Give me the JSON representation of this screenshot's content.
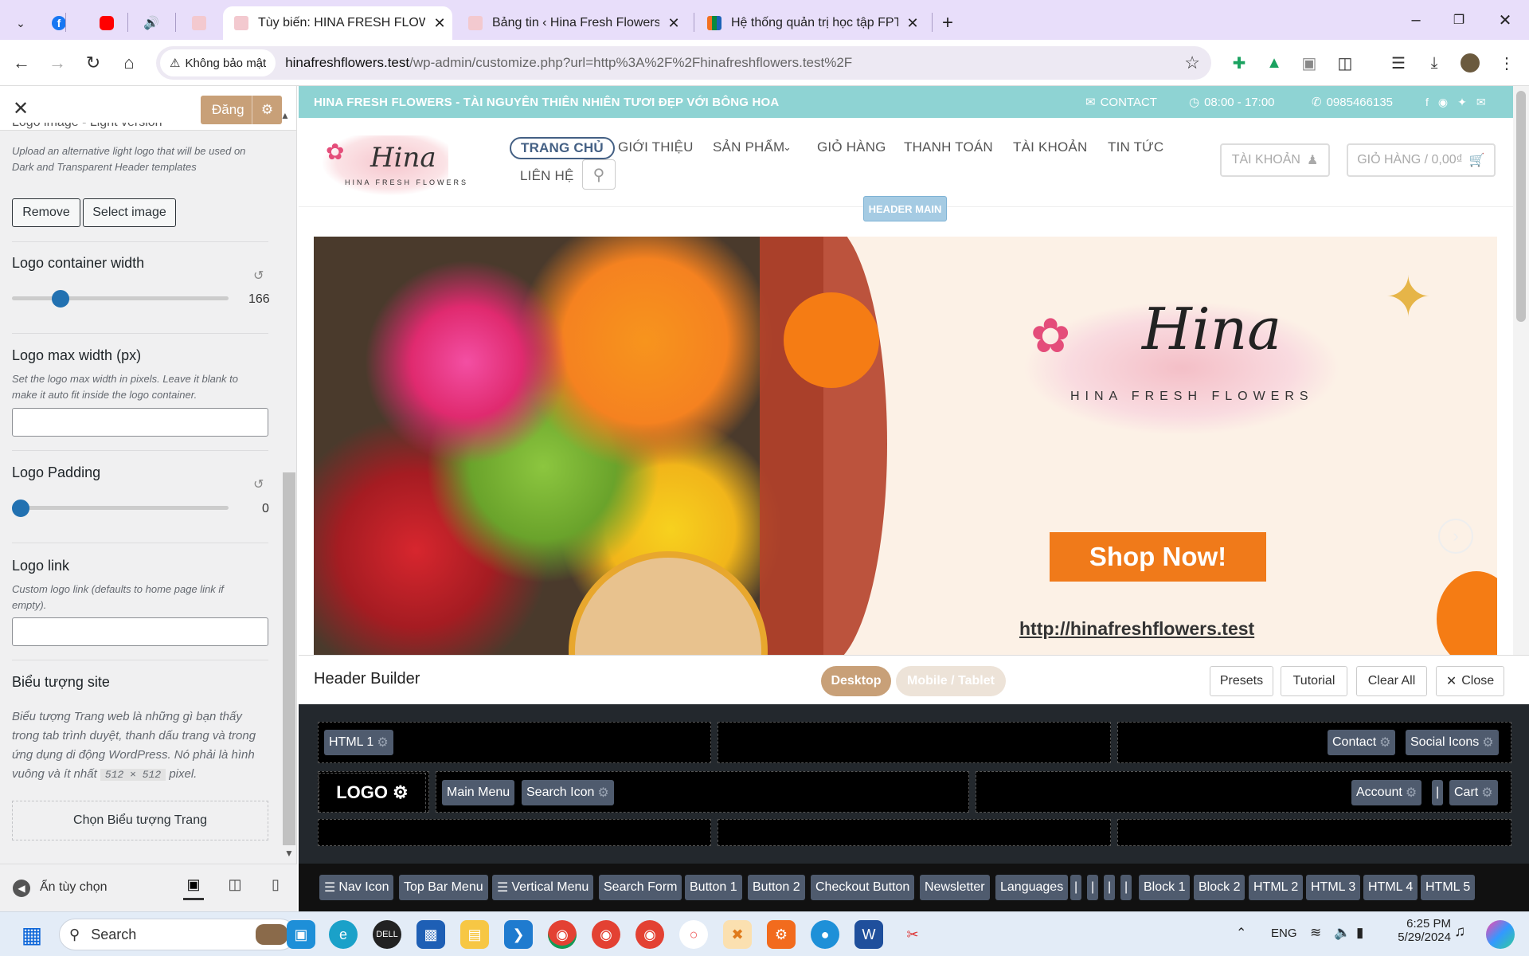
{
  "browser": {
    "tabs": [
      {
        "title": "",
        "favicon": "chevron-down-icon"
      },
      {
        "title": "",
        "favicon": "facebook-icon"
      },
      {
        "title": "",
        "favicon": "youtube-icon"
      },
      {
        "title": "",
        "favicon": "speaker-icon"
      },
      {
        "title": "",
        "favicon": "hina-icon"
      },
      {
        "title": "Tùy biến: HINA FRESH FLOWERS",
        "favicon": "hina-icon",
        "active": true
      },
      {
        "title": "Bảng tin ‹ Hina Fresh Flowers —",
        "favicon": "hina-icon"
      },
      {
        "title": "Hệ thống quản trị học tập FPT P",
        "favicon": "fpt-icon"
      }
    ],
    "new_tab": "+",
    "security_label": "Không bảo mật",
    "url_domain": "hinafreshflowers.test",
    "url_path": "/wp-admin/customize.php?url=http%3A%2F%2Fhinafreshflowers.test%2F"
  },
  "customizer": {
    "publish_label": "Đăng",
    "cut_title": "Logo image - Light version",
    "light_logo_desc": "Upload an alternative light logo that will be used on Dark and Transparent Header templates",
    "remove_label": "Remove",
    "select_image_label": "Select image",
    "container_width": {
      "label": "Logo container width",
      "value": "166",
      "level": 0.18
    },
    "max_width": {
      "label": "Logo max width (px)",
      "desc": "Set the logo max width in pixels. Leave it blank to make it auto fit inside the logo container.",
      "value": ""
    },
    "padding": {
      "label": "Logo Padding",
      "value": "0",
      "level": 0
    },
    "logo_link": {
      "label": "Logo link",
      "desc": "Custom logo link (defaults to home page link if empty).",
      "value": ""
    },
    "site_icon": {
      "label": "Biểu tượng site",
      "desc_1": "Biểu tượng Trang web là những gì bạn thấy trong tab trình duyệt, thanh dấu trang và trong ứng dụng di động WordPress. Nó phải là hình vuông và ít nhất",
      "size": "512 × 512",
      "desc_2": "pixel.",
      "button": "Chọn Biểu tượng Trang"
    },
    "hide_controls": "Ẩn tùy chọn"
  },
  "site": {
    "topbar_brand": "HINA FRESH FLOWERS - TÀI NGUYÊN THIÊN NHIÊN TƯƠI ĐẸP VỚI BÔNG HOA",
    "contact": "CONTACT",
    "hours": "08:00 - 17:00",
    "phone": "0985466135",
    "logo_script": "Hina",
    "logo_sub": "HINA FRESH FLOWERS",
    "menu": [
      "TRANG CHỦ",
      "GIỚI THIỆU",
      "SẢN PHẨM",
      "GIỎ HÀNG",
      "THANH TOÁN",
      "TÀI KHOẢN",
      "TIN TỨC",
      "LIÊN HỆ"
    ],
    "account_btn": "TÀI KHOẢN",
    "cart_btn": "GIỎ HÀNG / 0,00₫",
    "header_badge": "HEADER MAIN",
    "shop_now": "Shop Now!",
    "site_url": "http://hinafreshflowers.test",
    "banner_logo_script": "Hina",
    "banner_logo_sub": "HINA FRESH FLOWERS"
  },
  "builder": {
    "title": "Header Builder",
    "desktop": "Desktop",
    "mobile": "Mobile / Tablet",
    "presets": "Presets",
    "tutorial": "Tutorial",
    "clear_all": "Clear All",
    "close": "Close",
    "top_left": [
      "HTML 1"
    ],
    "top_right": [
      "Contact",
      "Social Icons"
    ],
    "logo": "LOGO",
    "main_left": [
      "Main Menu",
      "Search Icon"
    ],
    "main_right": [
      "Account",
      "|",
      "Cart"
    ],
    "available": [
      "Nav Icon",
      "Top Bar Menu",
      "Vertical Menu",
      "Search Form",
      "Button 1",
      "Button 2",
      "Checkout Button",
      "Newsletter",
      "Languages",
      "|",
      "|",
      "|",
      "|",
      "Block 1",
      "Block 2",
      "HTML 2",
      "HTML 3",
      "HTML 4",
      "HTML 5"
    ]
  },
  "taskbar": {
    "search": "Search",
    "lang": "ENG",
    "time": "6:25 PM",
    "date": "5/29/2024"
  }
}
